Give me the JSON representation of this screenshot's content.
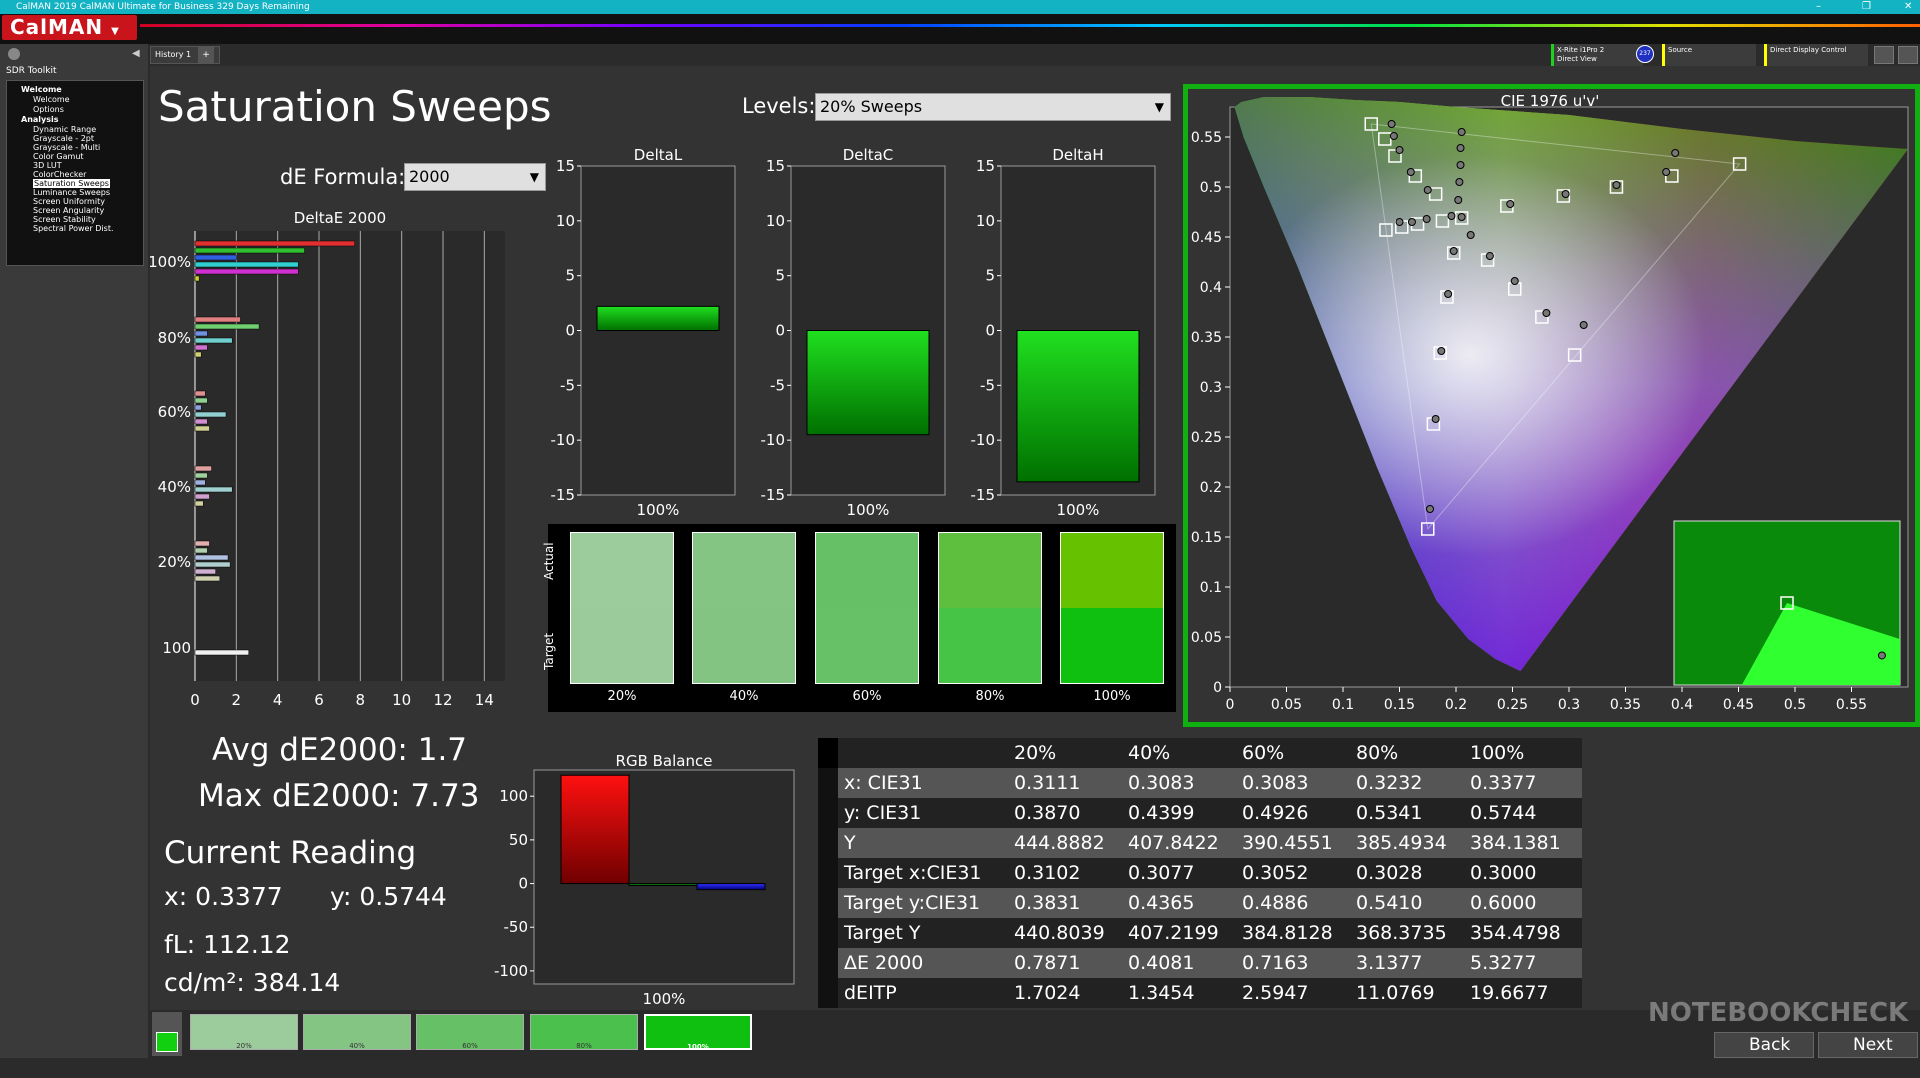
{
  "window": {
    "title": "CalMAN 2019 CalMAN Ultimate for Business 329 Days Remaining"
  },
  "app": {
    "logo": "CalMAN"
  },
  "sidebar": {
    "header": "SDR Toolkit",
    "items": [
      "Welcome",
      "Welcome",
      "Options",
      "Analysis",
      "Dynamic Range",
      "Grayscale - 2pt",
      "Grayscale - Multi",
      "Color Gamut",
      "3D LUT",
      "ColorChecker",
      "Saturation Sweeps",
      "Luminance Sweeps",
      "Screen Uniformity",
      "Screen Angularity",
      "Screen Stability",
      "Spectral Power Dist."
    ]
  },
  "history_tab": "History 1",
  "devices": {
    "meter_line1": "X-Rite i1Pro 2",
    "meter_line2": "Direct View",
    "meter_badge": "237",
    "source": "Source",
    "display": "Direct Display Control"
  },
  "page": {
    "title": "Saturation Sweeps",
    "levels_label": "Levels:",
    "levels_value": "20% Sweeps",
    "de_formula_label": "dE Formula:",
    "de_formula_value": "2000"
  },
  "summary": {
    "avg": "Avg dE2000: 1.7",
    "max": "Max dE2000: 7.73",
    "current_reading": "Current Reading",
    "x": "x: 0.3377",
    "y": "y: 0.5744",
    "fl": "fL: 112.12",
    "cdm2": "cd/m²: 384.14"
  },
  "swatches": {
    "actual_label": "Actual",
    "target_label": "Target",
    "labels": [
      "20%",
      "40%",
      "60%",
      "80%",
      "100%"
    ],
    "actual_colors": [
      "#9ccb9c",
      "#84c584",
      "#66c066",
      "#5ebf3f",
      "#66c100"
    ],
    "target_colors": [
      "#9bca9b",
      "#83c483",
      "#67c267",
      "#45c445",
      "#10c010"
    ]
  },
  "bottom_swatches": {
    "labels": [
      "20%",
      "40%",
      "60%",
      "80%",
      "100%"
    ],
    "colors": [
      "#9ccb9c",
      "#84c584",
      "#66c066",
      "#4cc04c",
      "#10c010"
    ]
  },
  "nav": {
    "back": "Back",
    "next": "Next"
  },
  "table": {
    "headers": [
      "20%",
      "40%",
      "60%",
      "80%",
      "100%"
    ],
    "rows": [
      {
        "label": "x: CIE31",
        "values": [
          "0.3111",
          "0.3083",
          "0.3083",
          "0.3232",
          "0.3377"
        ]
      },
      {
        "label": "y: CIE31",
        "values": [
          "0.3870",
          "0.4399",
          "0.4926",
          "0.5341",
          "0.5744"
        ]
      },
      {
        "label": "Y",
        "values": [
          "444.8882",
          "407.8422",
          "390.4551",
          "385.4934",
          "384.1381"
        ]
      },
      {
        "label": "Target x:CIE31",
        "values": [
          "0.3102",
          "0.3077",
          "0.3052",
          "0.3028",
          "0.3000"
        ]
      },
      {
        "label": "Target y:CIE31",
        "values": [
          "0.3831",
          "0.4365",
          "0.4886",
          "0.5410",
          "0.6000"
        ]
      },
      {
        "label": "Target Y",
        "values": [
          "440.8039",
          "407.2199",
          "384.8128",
          "368.3735",
          "354.4798"
        ]
      },
      {
        "label": "ΔE 2000",
        "values": [
          "0.7871",
          "0.4081",
          "0.7163",
          "3.1377",
          "5.3277"
        ]
      },
      {
        "label": "dEITP",
        "values": [
          "1.7024",
          "1.3454",
          "2.5947",
          "11.0769",
          "19.6677"
        ]
      }
    ]
  },
  "chart_data": [
    {
      "type": "bar",
      "title": "DeltaE 2000",
      "orientation": "horizontal",
      "categories": [
        "100%",
        "80%",
        "60%",
        "40%",
        "20%",
        "100"
      ],
      "xticks": [
        0,
        2,
        4,
        6,
        8,
        10,
        12,
        14
      ],
      "xlim": [
        0,
        15
      ],
      "groups": [
        {
          "label": "100%",
          "values": [
            7.73,
            5.3,
            2.0,
            5.0,
            5.0,
            0.2
          ],
          "colors": [
            "#e03030",
            "#30c030",
            "#3060e0",
            "#30d0d0",
            "#d030d0",
            "#d0d030"
          ]
        },
        {
          "label": "80%",
          "values": [
            2.2,
            3.1,
            0.6,
            1.8,
            0.6,
            0.3
          ],
          "colors": [
            "#e08080",
            "#70d070",
            "#7090e0",
            "#70d0d0",
            "#d070d0",
            "#d0d070"
          ]
        },
        {
          "label": "60%",
          "values": [
            0.5,
            0.6,
            0.3,
            1.5,
            0.6,
            0.7
          ],
          "colors": [
            "#e09090",
            "#90d090",
            "#90a0e0",
            "#90d0d0",
            "#d090d0",
            "#d0d090"
          ]
        },
        {
          "label": "40%",
          "values": [
            0.8,
            0.6,
            0.5,
            1.8,
            0.7,
            0.4
          ],
          "colors": [
            "#e0a0a0",
            "#a0d0a0",
            "#a0b0e0",
            "#a0d0d0",
            "#d0a0d0",
            "#d0d0a0"
          ]
        },
        {
          "label": "20%",
          "values": [
            0.7,
            0.6,
            1.6,
            1.7,
            1.0,
            1.2
          ],
          "colors": [
            "#e0b0b0",
            "#b0d0b0",
            "#b0c0e0",
            "#b0d0d0",
            "#d0b0d0",
            "#d0d0b0"
          ]
        },
        {
          "label": "100",
          "values": [
            2.6
          ],
          "colors": [
            "#f0f0f0"
          ]
        }
      ]
    },
    {
      "type": "bar",
      "title": "DeltaL",
      "categories": [
        "100%"
      ],
      "values": [
        2.2
      ],
      "ylim": [
        -15,
        15
      ],
      "yticks": [
        15,
        10,
        5,
        0,
        -5,
        -10,
        -15
      ]
    },
    {
      "type": "bar",
      "title": "DeltaC",
      "categories": [
        "100%"
      ],
      "values": [
        -9.5
      ],
      "ylim": [
        -15,
        15
      ],
      "yticks": [
        15,
        10,
        5,
        0,
        -5,
        -10,
        -15
      ]
    },
    {
      "type": "bar",
      "title": "DeltaH",
      "categories": [
        "100%"
      ],
      "values": [
        -13.8
      ],
      "ylim": [
        -15,
        15
      ],
      "yticks": [
        15,
        10,
        5,
        0,
        -5,
        -10,
        -15
      ]
    },
    {
      "type": "bar",
      "title": "RGB Balance",
      "categories": [
        "100%"
      ],
      "series": [
        {
          "values": [
            124
          ]
        },
        {
          "values": [
            -1
          ]
        },
        {
          "values": [
            -7
          ]
        }
      ],
      "colors": [
        "#ff0000",
        "#00aa00",
        "#2020ff"
      ],
      "ylim": [
        -115,
        130
      ],
      "yticks": [
        100,
        50,
        0,
        -50,
        -100
      ]
    },
    {
      "type": "scatter",
      "title": "CIE 1976 u'v'",
      "xticks": [
        0,
        0.05,
        0.1,
        0.15,
        0.2,
        0.25,
        0.3,
        0.35,
        0.4,
        0.45,
        0.5,
        0.55
      ],
      "yticks": [
        0,
        0.05,
        0.1,
        0.15,
        0.2,
        0.25,
        0.3,
        0.35,
        0.4,
        0.45,
        0.5,
        0.55
      ],
      "xlim": [
        0,
        0.6
      ],
      "ylim": [
        0,
        0.58
      ],
      "gamut_triangle": [
        [
          0.451,
          0.523
        ],
        [
          0.125,
          0.563
        ],
        [
          0.175,
          0.158
        ]
      ],
      "targets": [
        [
          0.451,
          0.523
        ],
        [
          0.125,
          0.563
        ],
        [
          0.175,
          0.158
        ],
        [
          0.205,
          0.469
        ],
        [
          0.391,
          0.511
        ],
        [
          0.342,
          0.5
        ],
        [
          0.295,
          0.491
        ],
        [
          0.245,
          0.481
        ],
        [
          0.137,
          0.548
        ],
        [
          0.146,
          0.531
        ],
        [
          0.164,
          0.511
        ],
        [
          0.182,
          0.493
        ],
        [
          0.305,
          0.332
        ],
        [
          0.276,
          0.37
        ],
        [
          0.252,
          0.398
        ],
        [
          0.228,
          0.427
        ],
        [
          0.138,
          0.457
        ],
        [
          0.152,
          0.46
        ],
        [
          0.166,
          0.463
        ],
        [
          0.188,
          0.466
        ],
        [
          0.18,
          0.263
        ],
        [
          0.186,
          0.334
        ],
        [
          0.192,
          0.39
        ],
        [
          0.198,
          0.434
        ]
      ],
      "measured": [
        [
          0.394,
          0.534
        ],
        [
          0.143,
          0.563
        ],
        [
          0.177,
          0.178
        ],
        [
          0.205,
          0.47
        ],
        [
          0.386,
          0.515
        ],
        [
          0.342,
          0.502
        ],
        [
          0.297,
          0.493
        ],
        [
          0.248,
          0.483
        ],
        [
          0.145,
          0.551
        ],
        [
          0.15,
          0.537
        ],
        [
          0.16,
          0.515
        ],
        [
          0.175,
          0.497
        ],
        [
          0.313,
          0.362
        ],
        [
          0.28,
          0.374
        ],
        [
          0.252,
          0.406
        ],
        [
          0.23,
          0.431
        ],
        [
          0.15,
          0.465
        ],
        [
          0.161,
          0.465
        ],
        [
          0.174,
          0.468
        ],
        [
          0.196,
          0.471
        ],
        [
          0.182,
          0.268
        ],
        [
          0.187,
          0.336
        ],
        [
          0.193,
          0.393
        ],
        [
          0.198,
          0.436
        ],
        [
          0.205,
          0.555
        ],
        [
          0.204,
          0.539
        ],
        [
          0.204,
          0.522
        ],
        [
          0.203,
          0.505
        ],
        [
          0.202,
          0.487
        ],
        [
          0.213,
          0.452
        ]
      ],
      "inset": {
        "target": [
          0.5,
          0.5
        ],
        "measured": [
          0.92,
          0.18
        ]
      }
    }
  ]
}
